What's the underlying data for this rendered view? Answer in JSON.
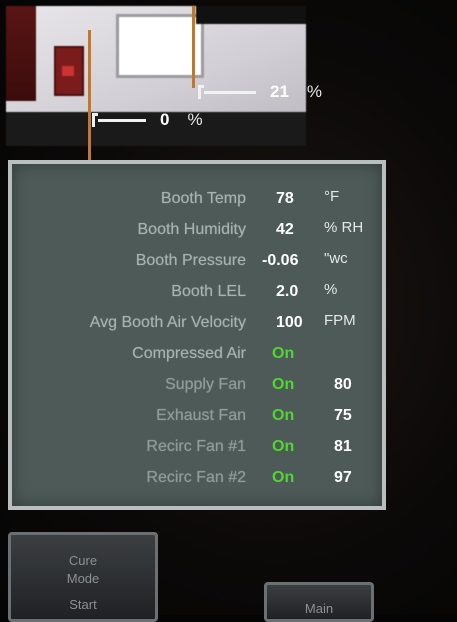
{
  "indicators": {
    "top": {
      "value": "21",
      "unit": "%"
    },
    "bottom": {
      "value": "0",
      "unit": "%"
    }
  },
  "status_rows": [
    {
      "label": "Booth Temp",
      "value": "78",
      "unit": "°F"
    },
    {
      "label": "Booth Humidity",
      "value": "42",
      "unit": "% RH"
    },
    {
      "label": "Booth Pressure",
      "value": "-0.06",
      "unit": "\"wc"
    },
    {
      "label": "Booth LEL",
      "value": "2.0",
      "unit": "%"
    },
    {
      "label": "Avg Booth Air Velocity",
      "value": "100",
      "unit": "FPM"
    },
    {
      "label": "Compressed Air",
      "value": "On",
      "unit": ""
    },
    {
      "label": "Supply Fan",
      "value": "On",
      "speed": "80"
    },
    {
      "label": "Exhaust Fan",
      "value": "On",
      "speed": "75"
    },
    {
      "label": "Recirc Fan #1",
      "value": "On",
      "speed": "81"
    },
    {
      "label": "Recirc Fan #2",
      "value": "On",
      "speed": "97"
    }
  ],
  "buttons": {
    "left": {
      "line1": "Cure",
      "line2": "Mode",
      "line3": "Start"
    },
    "right": {
      "line1": "Main"
    }
  },
  "colors": {
    "panel_bg": "#4d5a57",
    "on_green": "#4ed82e",
    "pipe": "#b47a3e"
  }
}
